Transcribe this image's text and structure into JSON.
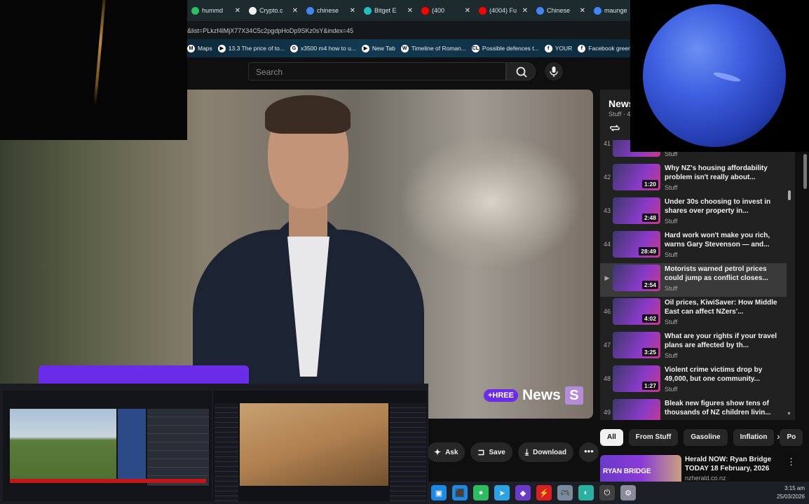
{
  "tabs": [
    {
      "label": "hummd",
      "color": "#30c060"
    },
    {
      "label": "Crypto.c",
      "color": "#f0f0f0"
    },
    {
      "label": "chinese",
      "color": "#4285f4"
    },
    {
      "label": "Bitget E",
      "color": "#20c0c0"
    },
    {
      "label": "(400",
      "color": "#ff0000"
    },
    {
      "label": "(4004) Fu",
      "color": "#ff0000"
    },
    {
      "label": "Chinese",
      "color": "#4285f4"
    },
    {
      "label": "maunge",
      "color": "#4285f4"
    }
  ],
  "tab_close": "✕",
  "url": "&list=PLkzf4lMjX77X34C5c2pgdpHoDp9SKz0sY&index=45",
  "bookmarks": [
    {
      "label": "Maps",
      "icon": "M"
    },
    {
      "label": "13.3 The price of to...",
      "icon": "▶"
    },
    {
      "label": "x3500 m4 how to u...",
      "icon": "G"
    },
    {
      "label": "New Tab",
      "icon": "▶"
    },
    {
      "label": "Timeline of Roman...",
      "icon": "W"
    },
    {
      "label": "Possible defences t...",
      "icon": "CL"
    },
    {
      "label": "YOUR",
      "icon": "f"
    },
    {
      "label": "Facebook green",
      "icon": "f"
    }
  ],
  "search": {
    "placeholder": "Search"
  },
  "video": {
    "brand_badge": "+HREE",
    "brand_word": "News",
    "brand_letter": "S"
  },
  "playlist": {
    "title": "News",
    "channel": "Stuff · 4",
    "items": [
      {
        "index": "41",
        "title": "",
        "channel": "Stuff",
        "duration": "",
        "active": false
      },
      {
        "index": "42",
        "title": "Why NZ's housing affordability problem isn't really about...",
        "channel": "Stuff",
        "duration": "1:20",
        "active": false
      },
      {
        "index": "43",
        "title": "Under 30s choosing to invest in shares over property in...",
        "channel": "Stuff",
        "duration": "2:48",
        "active": false
      },
      {
        "index": "44",
        "title": "Hard work won't make you rich, warns Gary Stevenson — and...",
        "channel": "Stuff",
        "duration": "28:49",
        "active": false
      },
      {
        "index": "▶",
        "title": "Motorists warned petrol prices could jump as conflict closes...",
        "channel": "Stuff",
        "duration": "2:54",
        "active": true
      },
      {
        "index": "46",
        "title": "Oil prices, KiwiSaver: How Middle East can affect NZers'...",
        "channel": "Stuff",
        "duration": "4:02",
        "active": false
      },
      {
        "index": "47",
        "title": "What are your rights if your travel plans are affected by th...",
        "channel": "Stuff",
        "duration": "3:25",
        "active": false
      },
      {
        "index": "48",
        "title": "Violent crime victims drop by 49,000, but one community...",
        "channel": "Stuff",
        "duration": "1:27",
        "active": false
      },
      {
        "index": "49",
        "title": "Bleak new figures show tens of thousands of NZ children livin...",
        "channel": "Stuff",
        "duration": "",
        "active": false
      }
    ]
  },
  "chips": [
    "All",
    "From Stuff",
    "Gasoline",
    "Inflation",
    "Po"
  ],
  "related": {
    "thumb_text": "RYAN BRIDGE",
    "title": "Herald NOW: Ryan Bridge TODAY 18 February, 2026",
    "channel": "nzherald.co.nz"
  },
  "actions": {
    "ask": "Ask",
    "save": "Save",
    "download": "Download"
  },
  "clock": {
    "time": "3:15 am",
    "date": "25/03/2026"
  },
  "taskbar_icons": [
    "#1e88e5",
    "#1e88e5",
    "#2bbd60",
    "#2aa3e0",
    "#6a3ac8",
    "#d82020",
    "#7a8aa0",
    "#2ab0a0",
    "#404040",
    "#8a8a9a"
  ]
}
